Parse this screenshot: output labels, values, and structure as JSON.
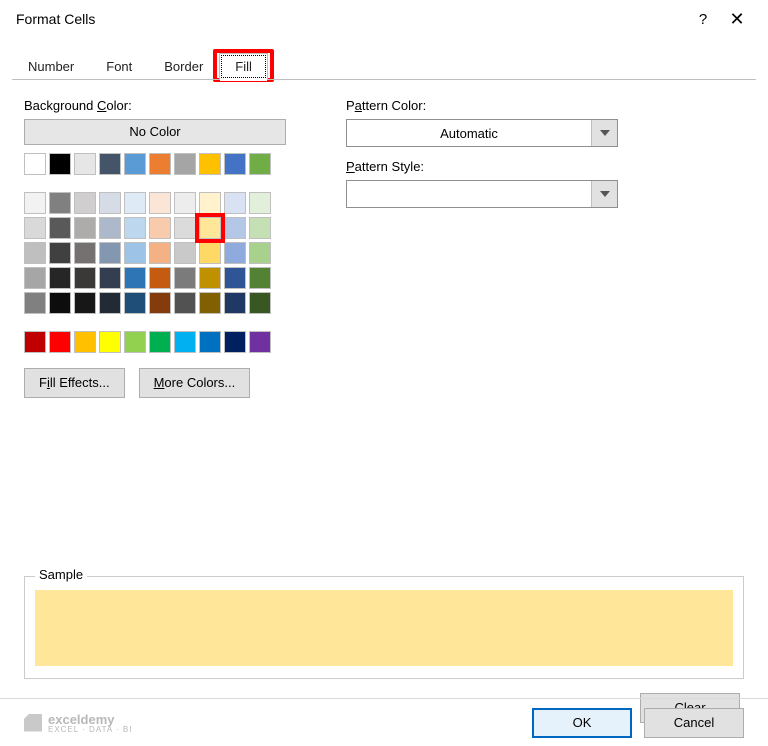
{
  "title": "Format Cells",
  "tabs": {
    "number": "Number",
    "font": "Font",
    "border": "Border",
    "fill": "Fill"
  },
  "labels": {
    "background_color": "Background Color:",
    "no_color": "No Color",
    "fill_effects": "Fill Effects...",
    "more_colors": "More Colors...",
    "pattern_color": "Pattern Color:",
    "pattern_style": "Pattern Style:",
    "sample": "Sample",
    "clear": "Clear",
    "ok": "OK",
    "cancel": "Cancel",
    "automatic": "Automatic"
  },
  "swatch_rows_top": [
    [
      "#ffffff",
      "#000000",
      "#e7e6e6",
      "#445569",
      "#5b9bd5",
      "#ed7d31",
      "#a5a5a5",
      "#ffc000",
      "#4472c4",
      "#70ad47"
    ]
  ],
  "swatch_rows_main": [
    [
      "#f2f2f2",
      "#808080",
      "#d0cece",
      "#d6dce5",
      "#deebf7",
      "#fbe5d6",
      "#ededed",
      "#fff2cc",
      "#d9e2f3",
      "#e2efda"
    ],
    [
      "#d9d9d9",
      "#595959",
      "#aeabab",
      "#adb9ca",
      "#bdd7ee",
      "#f8cbad",
      "#dbdbdb",
      "#ffe699",
      "#b4c7e7",
      "#c5e0b4"
    ],
    [
      "#bfbfbf",
      "#404040",
      "#757171",
      "#8497b0",
      "#9dc3e6",
      "#f4b183",
      "#c9c9c9",
      "#ffd966",
      "#8faadc",
      "#a9d18e"
    ],
    [
      "#a6a6a6",
      "#262626",
      "#3b3838",
      "#333f50",
      "#2e75b6",
      "#c55a11",
      "#7b7b7b",
      "#bf9000",
      "#2f5597",
      "#548235"
    ],
    [
      "#808080",
      "#0d0d0d",
      "#171717",
      "#222a35",
      "#1f4e79",
      "#843c0c",
      "#525252",
      "#806000",
      "#203864",
      "#385723"
    ]
  ],
  "swatch_rows_std": [
    [
      "#c00000",
      "#ff0000",
      "#ffc000",
      "#ffff00",
      "#92d050",
      "#00b050",
      "#00b0f0",
      "#0070c0",
      "#002060",
      "#7030a0"
    ]
  ],
  "selected_swatch": {
    "row": 1,
    "col": 7
  },
  "sample_color": "#ffe699",
  "watermark": {
    "brand": "exceldemy",
    "sub": "EXCEL · DATA · BI"
  }
}
